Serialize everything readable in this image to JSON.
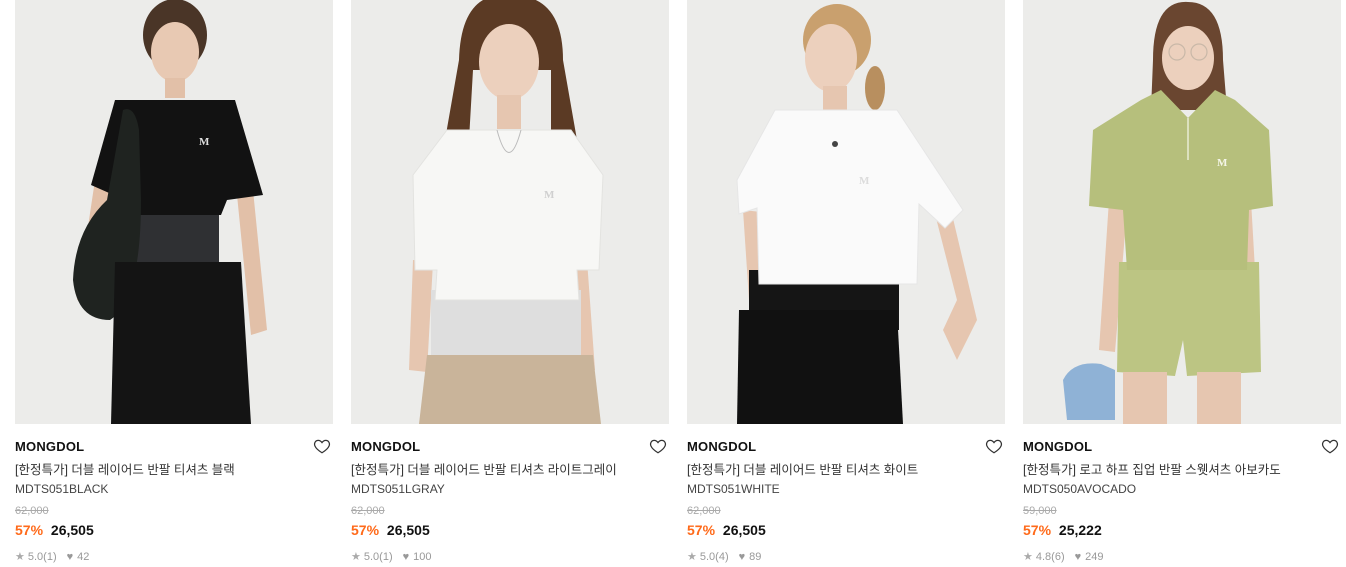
{
  "products": [
    {
      "brand": "MONGDOL",
      "name": "[한정특가] 더블 레이어드 반팔 티셔츠 블랙",
      "code": "MDTS051BLACK",
      "original_price": "62,000",
      "discount": "57%",
      "price": "26,505",
      "rating": "5.0",
      "reviews": "(1)",
      "likes": "42",
      "top_color": "#121212",
      "bottom_color": "#141414",
      "accent_color": "#2f3033"
    },
    {
      "brand": "MONGDOL",
      "name": "[한정특가] 더블 레이어드 반팔 티셔츠 라이트그레이",
      "code": "MDTS051LGRAY",
      "original_price": "62,000",
      "discount": "57%",
      "price": "26,505",
      "rating": "5.0",
      "reviews": "(1)",
      "likes": "100",
      "top_color": "#f7f7f5",
      "bottom_color": "#c9b49a",
      "accent_color": "#dedede"
    },
    {
      "brand": "MONGDOL",
      "name": "[한정특가] 더블 레이어드 반팔 티셔츠 화이트",
      "code": "MDTS051WHITE",
      "original_price": "62,000",
      "discount": "57%",
      "price": "26,505",
      "rating": "5.0",
      "reviews": "(4)",
      "likes": "89",
      "top_color": "#fafafa",
      "bottom_color": "#111111",
      "accent_color": "#151515"
    },
    {
      "brand": "MONGDOL",
      "name": "[한정특가] 로고 하프 집업 반팔 스웻셔츠 아보카도",
      "code": "MDTS050AVOCADO",
      "original_price": "59,000",
      "discount": "57%",
      "price": "25,222",
      "rating": "4.8",
      "reviews": "(6)",
      "likes": "249",
      "top_color": "#b6bf7c",
      "bottom_color": "#bcc583",
      "accent_color": "#8fb2d6"
    }
  ],
  "icons": {
    "wishlist": "heart-outline-icon",
    "rating": "star-icon",
    "likes": "heart-filled-icon"
  },
  "colors": {
    "discount": "#ff6a1a",
    "photo_bg": "#ececea"
  }
}
